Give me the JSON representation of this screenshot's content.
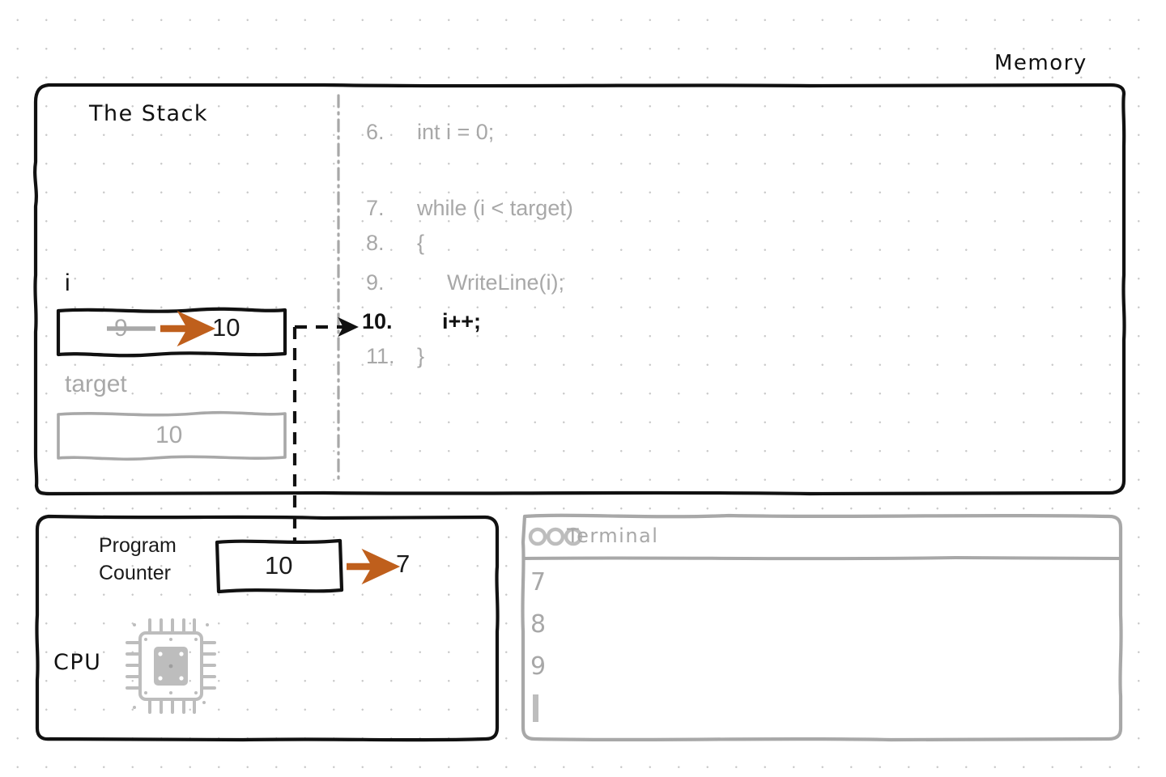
{
  "diagram": {
    "memory_title": "Memory",
    "stack_title": "The Stack",
    "cpu_title": "CPU",
    "accent_color": "#bf5f1c",
    "ink_color": "#111111",
    "muted_color": "#a8a8a8"
  },
  "stack": {
    "variables": [
      {
        "name": "i",
        "old_value": "9",
        "new_value": "10",
        "state": "changing"
      },
      {
        "name": "target",
        "value": "10",
        "state": "static"
      }
    ]
  },
  "code": {
    "lines": [
      {
        "number": "6.",
        "text": "int i = 0;",
        "current": false
      },
      {
        "number": "7.",
        "text": "while (i < target)",
        "current": false
      },
      {
        "number": "8.",
        "text": "{",
        "current": false
      },
      {
        "number": "9.",
        "text": "WriteLine(i);",
        "current": false
      },
      {
        "number": "10.",
        "text": "i++;",
        "current": true
      },
      {
        "number": "11.",
        "text": "}",
        "current": false
      }
    ]
  },
  "cpu": {
    "program_counter_label_line1": "Program",
    "program_counter_label_line2": "Counter",
    "program_counter_old": "10",
    "program_counter_new": "7",
    "chip_icon": "cpu-chip-icon"
  },
  "terminal": {
    "title": "Terminal",
    "traffic_lights": [
      "circle-icon",
      "circle-icon",
      "circle-icon"
    ],
    "output_lines": [
      "7",
      "8",
      "9"
    ],
    "cursor": "text-cursor"
  }
}
